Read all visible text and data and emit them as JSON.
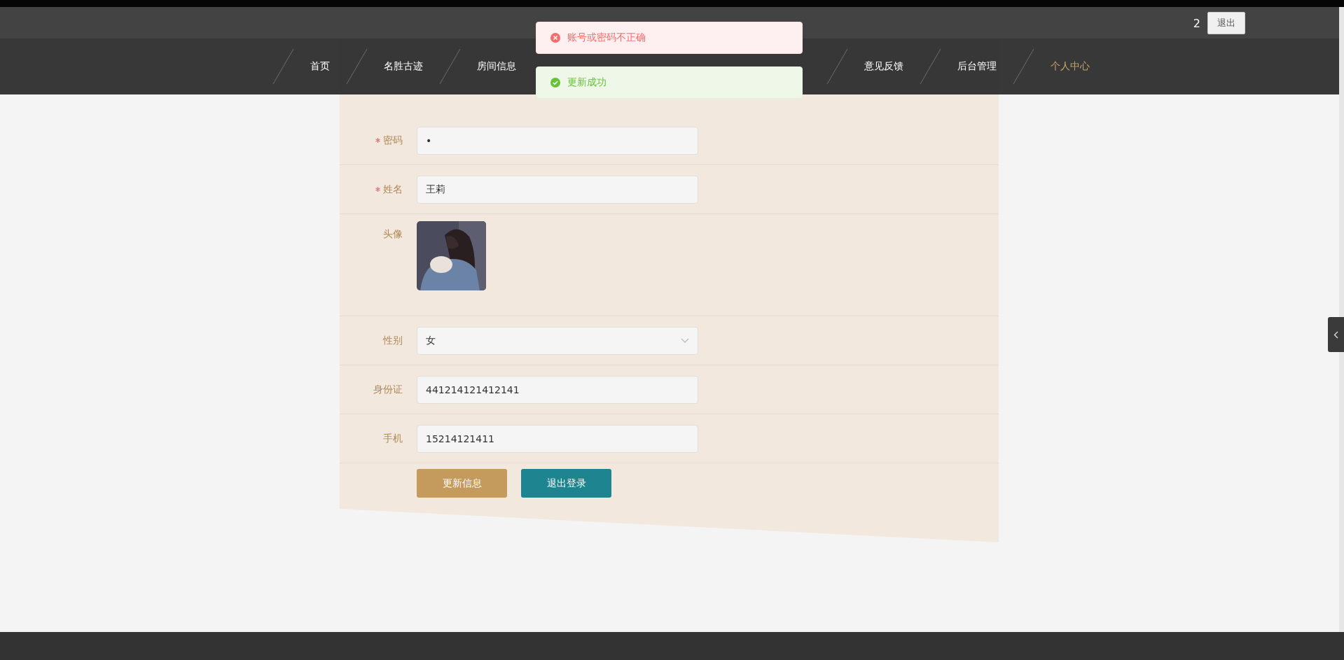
{
  "header": {
    "username": "2",
    "logout": "退出"
  },
  "nav_left": [
    {
      "label": "首页",
      "selected": false
    },
    {
      "label": "名胜古迹",
      "selected": false
    },
    {
      "label": "房间信息",
      "selected": false
    }
  ],
  "nav_right": [
    {
      "label": "意见反馈",
      "selected": false
    },
    {
      "label": "后台管理",
      "selected": false
    },
    {
      "label": "个人中心",
      "selected": true
    }
  ],
  "toasts": [
    {
      "kind": "error",
      "text": "账号或密码不正确"
    },
    {
      "kind": "success",
      "text": "更新成功"
    }
  ],
  "form": {
    "fields": [
      {
        "kind": "input",
        "label": "密码",
        "required": true,
        "value": "•"
      },
      {
        "kind": "input",
        "label": "姓名",
        "required": true,
        "value": "王莉"
      },
      {
        "label": "头像",
        "required": false
      },
      {
        "kind": "select",
        "label": "性别",
        "required": false,
        "value": "女"
      },
      {
        "kind": "input",
        "label": "身份证",
        "required": false,
        "value": "441214121412141"
      },
      {
        "kind": "input",
        "label": "手机",
        "required": false,
        "value": "15214121411"
      }
    ],
    "buttons": [
      {
        "kind": "primary",
        "label": "更新信息"
      },
      {
        "kind": "secondary",
        "label": "退出登录"
      }
    ]
  }
}
